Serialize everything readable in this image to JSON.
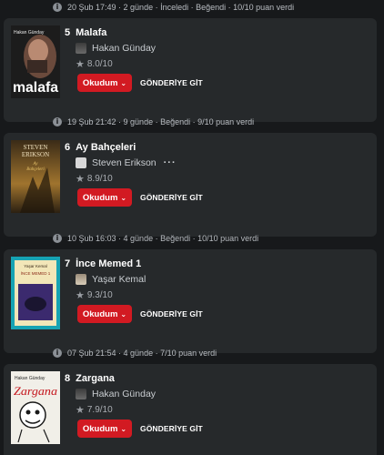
{
  "entries": [
    {
      "meta": "20 Şub 17:49 · 2 günde · İnceledi · Beğendi · 10/10 puan verdi",
      "rank": "5",
      "title": "Malafa",
      "author": "Hakan Günday",
      "rating": "8.0/10",
      "cover_lines": [
        "Hakan Günday",
        "malafa"
      ],
      "show_more": false
    },
    {
      "meta": "19 Şub 21:42 · 9 günde · Beğendi · 9/10 puan verdi",
      "rank": "6",
      "title": "Ay Bahçeleri",
      "author": "Steven Erikson",
      "rating": "8.9/10",
      "cover_lines": [
        "STEVEN",
        "ERIKSON",
        "Ay",
        "Bahçeleri"
      ],
      "show_more": true
    },
    {
      "meta": "10 Şub 16:03 · 4 günde · Beğendi · 10/10 puan verdi",
      "rank": "7",
      "title": "İnce Memed 1",
      "author": "Yaşar Kemal",
      "rating": "9.3/10",
      "cover_lines": [
        "Yaşar Kemal",
        "İNCE MEMED 1"
      ],
      "show_more": false
    },
    {
      "meta": "07 Şub 21:54 · 4 günde · 7/10 puan verdi",
      "rank": "8",
      "title": "Zargana",
      "author": "Hakan Günday",
      "rating": "7.9/10",
      "cover_lines": [
        "Hakan Günday",
        "Zargana"
      ],
      "show_more": false
    }
  ],
  "actions": {
    "read_label": "Okudum",
    "go_label": "GÖNDERİYE GİT"
  },
  "colors": {
    "accent": "#d21a22",
    "card_bg": "#26292b",
    "page_bg": "#17191b"
  }
}
